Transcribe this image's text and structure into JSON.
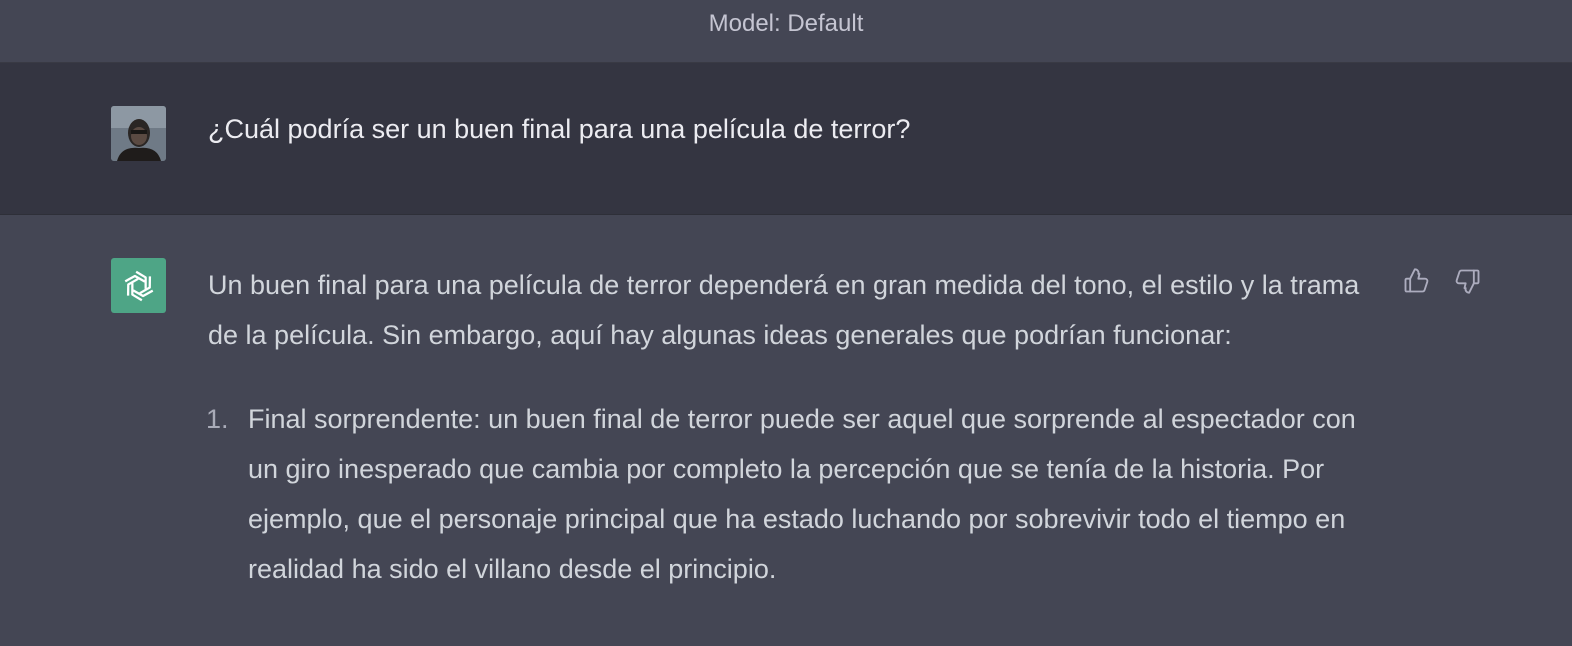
{
  "header": {
    "model_label": "Model: Default"
  },
  "user_message": {
    "text": "¿Cuál podría ser un buen final para una película de terror?"
  },
  "assistant_message": {
    "intro": "Un buen final para una película de terror dependerá en gran medida del tono, el estilo y la trama de la película. Sin embargo, aquí hay algunas ideas generales que podrían funcionar:",
    "items": [
      {
        "number": "1.",
        "text": "Final sorprendente: un buen final de terror puede ser aquel que sorprende al espectador con un giro inesperado que cambia por completo la percepción que se tenía de la historia. Por ejemplo, que el personaje principal que ha estado luchando por sobrevivir todo el tiempo en realidad ha sido el villano desde el principio."
      }
    ]
  },
  "icons": {
    "thumbs_up": "thumbs-up-icon",
    "thumbs_down": "thumbs-down-icon",
    "assistant_logo": "openai-logo-icon"
  },
  "colors": {
    "assistant_avatar_bg": "#4ea586",
    "user_row_bg": "#343541",
    "assistant_row_bg": "#444654"
  }
}
